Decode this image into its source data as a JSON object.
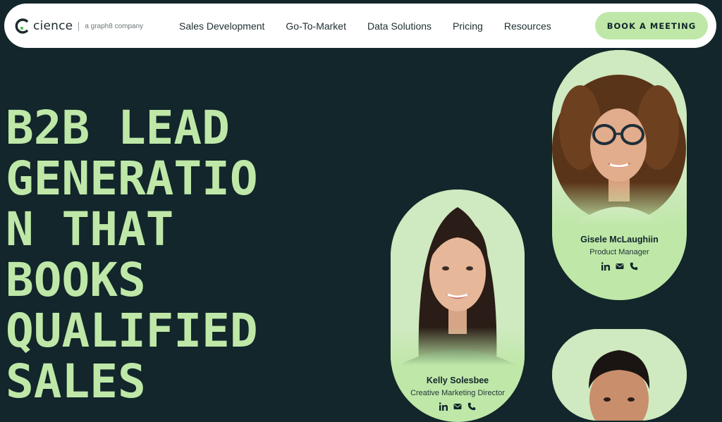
{
  "brand": {
    "name": "cience",
    "tagline": "a graph8 company"
  },
  "nav": {
    "items": [
      {
        "label": "Sales Development"
      },
      {
        "label": "Go-To-Market"
      },
      {
        "label": "Data Solutions"
      },
      {
        "label": "Pricing"
      },
      {
        "label": "Resources"
      }
    ],
    "cta_label": "BOOK A MEETING"
  },
  "hero": {
    "headline_lines": [
      "B2B LEAD",
      "GENERATIO",
      "N THAT",
      "BOOKS",
      "QUALIFIED",
      "SALES"
    ]
  },
  "people": [
    {
      "name": "Gisele McLaughiin",
      "role": "Product Manager",
      "icons": [
        "linkedin-icon",
        "mail-icon",
        "phone-icon"
      ]
    },
    {
      "name": "Kelly Solesbee",
      "role": "Creative Marketing Director",
      "icons": [
        "linkedin-icon",
        "mail-icon",
        "phone-icon"
      ]
    }
  ],
  "colors": {
    "background": "#12262b",
    "accent": "#bfe8a8",
    "nav_bg": "#ffffff"
  }
}
